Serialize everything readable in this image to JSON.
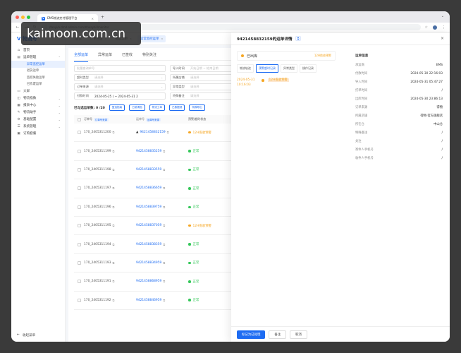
{
  "browser": {
    "tab_title": "EMS物流交付管理平台",
    "url": "/fanyi/a.dmd.admin.com/#/waybillmonitor",
    "new_tab": "+"
  },
  "watermark": {
    "text": "kaimoon.com.cn"
  },
  "sidebar": {
    "brand": "V 物流号",
    "items": [
      {
        "label": "首页",
        "icon": "home-icon"
      },
      {
        "label": "运单管理",
        "icon": "list-icon"
      }
    ],
    "subitems": [
      "异常监控运单",
      "退货运单",
      "监控失败运单",
      "已作废运单"
    ],
    "items2": [
      {
        "label": "大屏"
      },
      {
        "label": "物流指数"
      },
      {
        "label": "报表中心"
      },
      {
        "label": "物流助手"
      },
      {
        "label": "基础配置"
      },
      {
        "label": "系统管理"
      },
      {
        "label": "订购套餐"
      }
    ],
    "collapse": "收起菜单"
  },
  "topnav": {
    "tabs": [
      {
        "label": "首页"
      },
      {
        "label": "订单回址"
      },
      {
        "label": "物流工单"
      },
      {
        "label": "异常监控运单"
      }
    ]
  },
  "main": {
    "subtabs": [
      "全部运单",
      "异常运单",
      "已签收",
      "特别关注"
    ],
    "filters": [
      {
        "placeholder": "批量查询单号"
      },
      {
        "label": "导入时间",
        "value": "开始日期 ~ 结束日期"
      },
      {
        "label": "超时类型",
        "placeholder": "请选择"
      },
      {
        "label": "所属店铺",
        "placeholder": "请选择"
      },
      {
        "label": "订单来源",
        "placeholder": "请选择"
      },
      {
        "label": "异常类型",
        "placeholder": "请选择"
      },
      {
        "label": "付款时间",
        "value": "2024-05-25 ( ~ 2024-05-31 2"
      },
      {
        "label": "特殊备注",
        "placeholder": "请选择"
      }
    ],
    "selected_count": "已勾选运单数: 0 /20",
    "actions": [
      "复选指南",
      "已耐请指",
      "物流工单",
      "已数据观",
      "特殊导出"
    ],
    "columns": [
      "订单号",
      "运单号",
      "预警/超时状态"
    ],
    "column_tags": [
      "订单号来源",
      "运单号来源"
    ],
    "rows": [
      {
        "order": "170_2405311200",
        "waybill": "9421458832159",
        "status": "12H揽收预警",
        "status_type": "warn",
        "flag": true
      },
      {
        "order": "170_2405311199",
        "waybill": "9421458835259",
        "status": "正常",
        "status_type": "ok"
      },
      {
        "order": "170_2405311198",
        "waybill": "9421458833559",
        "status": "正常",
        "status_type": "ok"
      },
      {
        "order": "170_2405311197",
        "waybill": "9421458836659",
        "status": "正常",
        "status_type": "ok"
      },
      {
        "order": "170_2405311196",
        "waybill": "9421458839759",
        "status": "正常",
        "status_type": "ok"
      },
      {
        "order": "170_2405311195",
        "waybill": "9421458837059",
        "status": "12H揽收预警",
        "status_type": "warn"
      },
      {
        "order": "170_2405311194",
        "waybill": "9421458838359",
        "status": "正常",
        "status_type": "ok"
      },
      {
        "order": "170_2405311193",
        "waybill": "9421458834959",
        "status": "正常",
        "status_type": "ok"
      },
      {
        "order": "170_2405311191",
        "waybill": "9421458868959",
        "status": "正常",
        "status_type": "ok"
      },
      {
        "order": "170_2405311192",
        "waybill": "9421458846959",
        "status": "正常",
        "status_type": "ok"
      }
    ]
  },
  "drawer": {
    "title": "9421458832159的运单详情",
    "copy": "⧉",
    "status": "已出库",
    "status_warn": "12H揽收预警",
    "tabs": [
      "物流轨迹",
      "预警超时记录",
      "异常类型",
      "操作记录"
    ],
    "timeline": {
      "date": "2024-05-31 10:16:03",
      "label": "12H揽收预警"
    },
    "info_title": "运单信息",
    "info": [
      {
        "k": "承运商",
        "v": "EMS"
      },
      {
        "k": "付款时间",
        "v": "2024-05-30 22:16:03"
      },
      {
        "k": "导入时间",
        "v": "2024-05-31 05:47:27"
      },
      {
        "k": "打单时间",
        "v": "/"
      },
      {
        "k": "出库时间",
        "v": "2024-05-30 23:86:13"
      },
      {
        "k": "订单来源",
        "v": "得物"
      },
      {
        "k": "所属店铺",
        "v": "得物-官方旗舰店"
      },
      {
        "k": "所在仓",
        "v": "中山仓"
      },
      {
        "k": "特殊备注",
        "v": "/"
      },
      {
        "k": "关注",
        "v": "/"
      },
      {
        "k": "寄件人手机号",
        "v": "/"
      },
      {
        "k": "收件人手机号",
        "v": "/"
      }
    ],
    "buttons": [
      "标记为已处理",
      "备注",
      "取消"
    ]
  }
}
